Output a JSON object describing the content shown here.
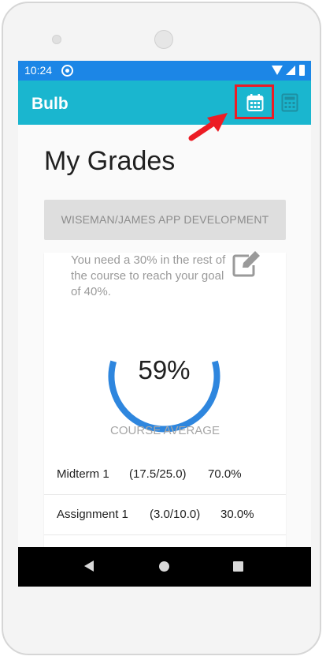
{
  "status_bar": {
    "time": "10:24"
  },
  "app_bar": {
    "title": "Bulb",
    "icons": [
      "calendar-icon",
      "calculator-icon"
    ]
  },
  "page": {
    "title": "My Grades"
  },
  "course_selector": {
    "label": "WISEMAN/JAMES APP DEVELOPMENT"
  },
  "grade_card": {
    "goal_message": "You need a 30% in the rest of the course to reach your goal of 40%.",
    "average_value": "59%",
    "average_progress": 0.59,
    "average_caption": "COURSE AVERAGE",
    "ring_color": "#2e86de",
    "items": [
      {
        "name": "Midterm 1",
        "score": "(17.5/25.0)",
        "percent": "70.0%"
      },
      {
        "name": "Assignment 1",
        "score": "(3.0/10.0)",
        "percent": "30.0%"
      }
    ]
  },
  "colors": {
    "status_bar": "#1c86e6",
    "app_bar": "#1ab6cf",
    "highlight": "#ec1c24"
  }
}
